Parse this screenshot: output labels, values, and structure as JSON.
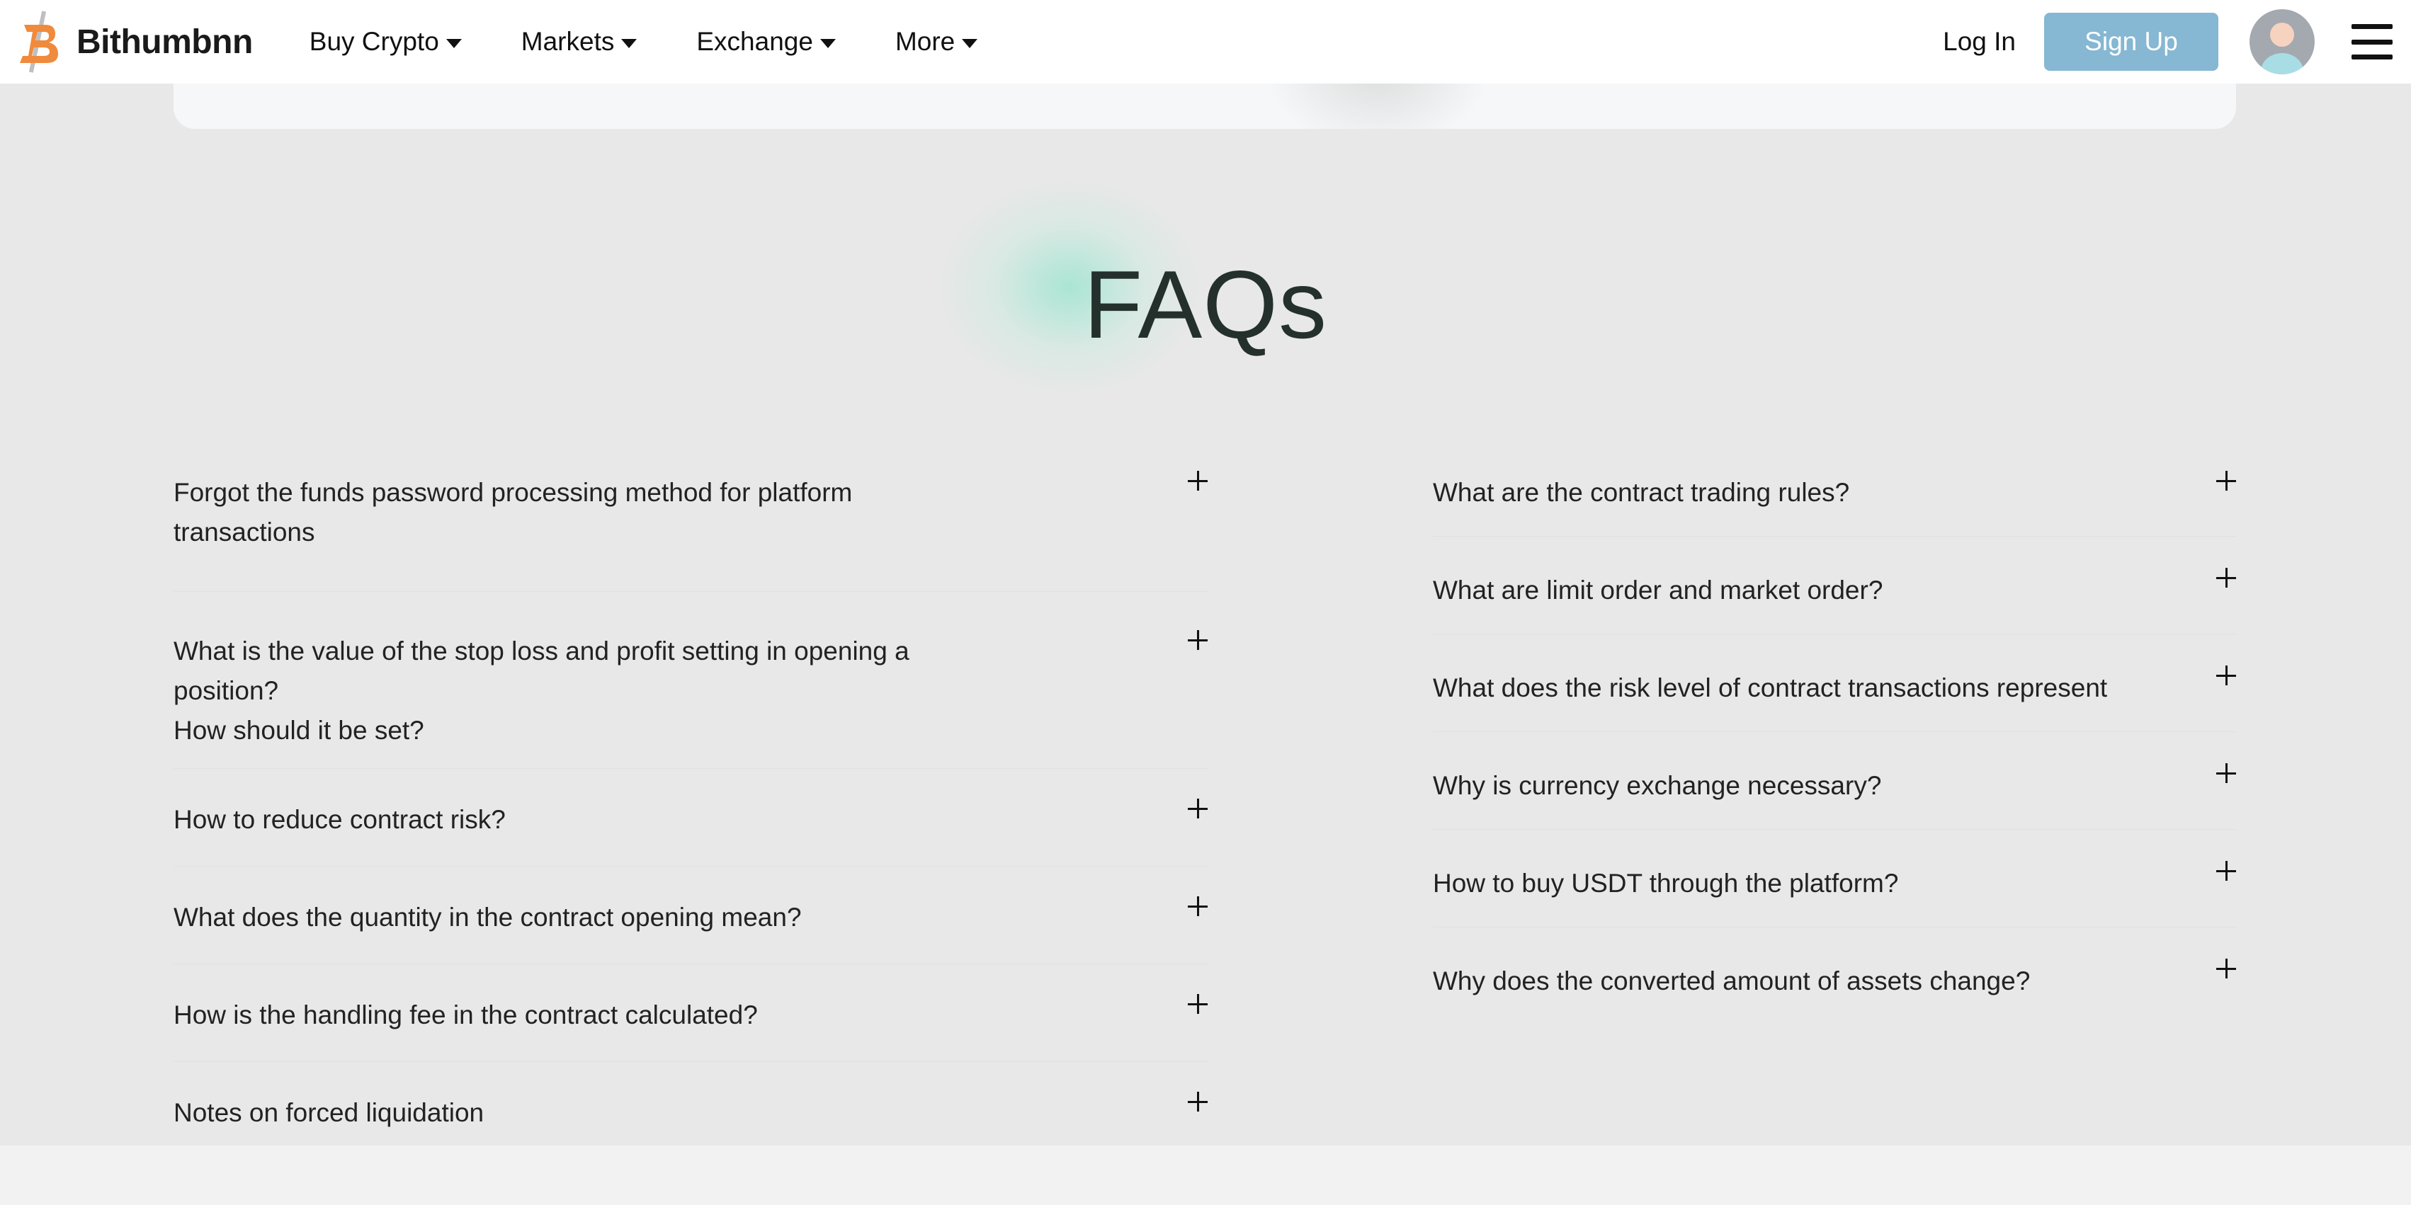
{
  "header": {
    "brand": "Bithumbnn",
    "nav": [
      {
        "label": "Buy Crypto"
      },
      {
        "label": "Markets"
      },
      {
        "label": "Exchange"
      },
      {
        "label": "More"
      }
    ],
    "login_label": "Log In",
    "signup_label": "Sign Up",
    "colors": {
      "signup_bg": "#86b7d3",
      "logo_orange": "#f08a3c"
    }
  },
  "faq": {
    "title": "FAQs",
    "left": [
      {
        "question": "Forgot the funds password processing method for platform\ntransactions"
      },
      {
        "question": "What is the value of the stop loss and profit setting in opening a\nposition?\nHow should it be set?"
      },
      {
        "question": "How to reduce contract risk?"
      },
      {
        "question": "What does the quantity in the contract opening mean?"
      },
      {
        "question": "How is the handling fee in the contract calculated?"
      },
      {
        "question": "Notes on forced liquidation"
      }
    ],
    "right": [
      {
        "question": "What are the contract trading rules?"
      },
      {
        "question": "What are limit order and market order?"
      },
      {
        "question": "What does the risk level of contract transactions represent"
      },
      {
        "question": "Why is currency exchange necessary?"
      },
      {
        "question": "How to buy USDT through the platform?"
      },
      {
        "question": "Why does the converted amount of assets change?"
      }
    ],
    "expand_icon": "plus-icon"
  }
}
